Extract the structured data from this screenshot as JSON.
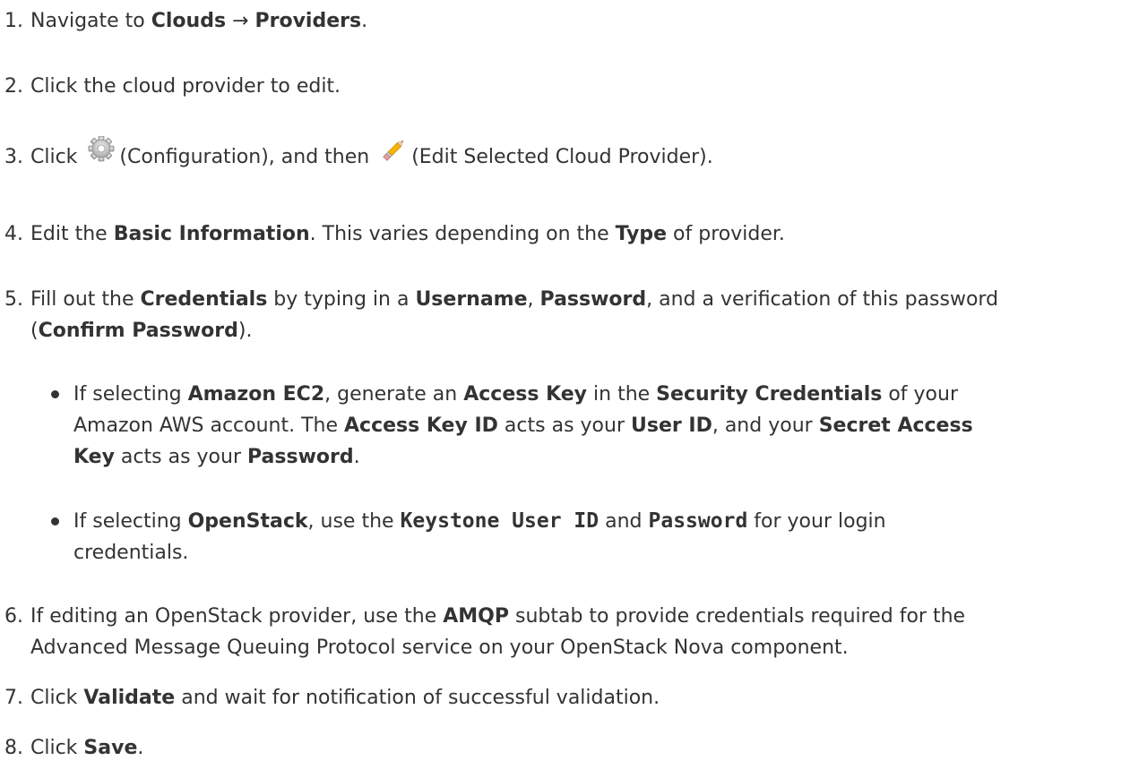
{
  "steps": {
    "s1": {
      "num": "1.",
      "t1": "Navigate to ",
      "b1": "Clouds",
      "arrow": " → ",
      "b2": "Providers",
      "t2": "."
    },
    "s2": {
      "num": "2.",
      "t1": "Click the cloud provider to edit."
    },
    "s3": {
      "num": "3.",
      "t1": "Click ",
      "t2": "(Configuration), and then ",
      "t3": "(Edit Selected Cloud Provider).",
      "icon1": "gear-icon",
      "icon2": "pencil-icon"
    },
    "s4": {
      "num": "4.",
      "t1": "Edit the ",
      "b1": "Basic Information",
      "t2": ". This varies depending on the ",
      "b2": "Type",
      "t3": " of provider."
    },
    "s5": {
      "num": "5.",
      "t1": "Fill out the ",
      "b1": "Credentials",
      "t2": " by typing in a ",
      "b2": "Username",
      "t3": ", ",
      "b3": "Password",
      "t4": ", and a verification of this password",
      "l2_t1": "(",
      "l2_b1": "Confirm Password",
      "l2_t2": ")."
    },
    "s5a": {
      "t1": "If selecting ",
      "b1": "Amazon EC2",
      "t2": ", generate an ",
      "b2": "Access Key",
      "t3": " in the ",
      "b3": "Security Credentials",
      "t4": " of your",
      "l2_t1": "Amazon AWS account. The ",
      "l2_b1": "Access Key ID",
      "l2_t2": " acts as your ",
      "l2_b2": "User ID",
      "l2_t3": ", and your ",
      "l2_b3": "Secret Access",
      "l3_b1": "Key",
      "l3_t1": " acts as your ",
      "l3_b2": "Password",
      "l3_t2": "."
    },
    "s5b": {
      "t1": "If selecting ",
      "b1": "OpenStack",
      "t2": ", use the ",
      "m1": "Keystone User ID",
      "t3": " and ",
      "m2": "Password",
      "t4": " for your login",
      "l2_t1": "credentials."
    },
    "s6": {
      "num": "6.",
      "t1": "If editing an OpenStack provider, use the ",
      "b1": "AMQP",
      "t2": " subtab to provide credentials required for the",
      "l2_t1": "Advanced Message Queuing Protocol service on your OpenStack Nova component."
    },
    "s7": {
      "num": "7.",
      "t1": "Click ",
      "b1": "Validate",
      "t2": " and wait for notification of successful validation."
    },
    "s8": {
      "num": "8.",
      "t1": "Click ",
      "b1": "Save",
      "t2": "."
    }
  }
}
